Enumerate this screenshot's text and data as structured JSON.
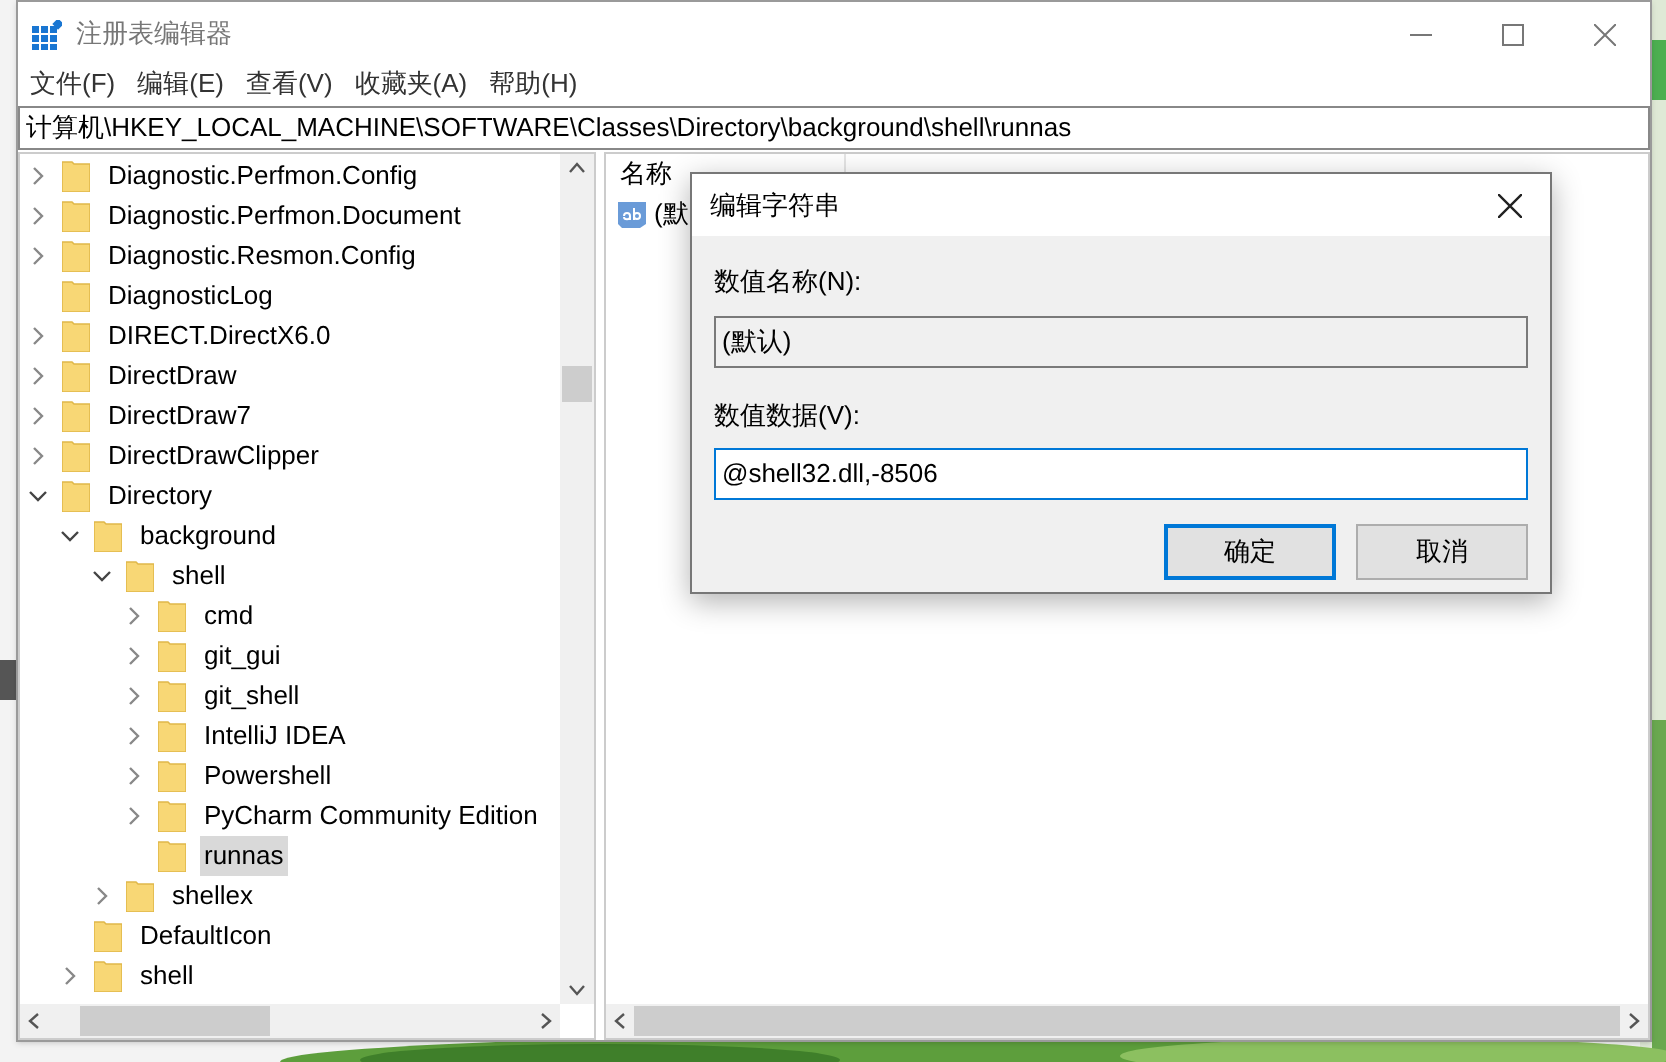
{
  "window": {
    "title": "注册表编辑器"
  },
  "menu": [
    {
      "label": "文件(F)"
    },
    {
      "label": "编辑(E)"
    },
    {
      "label": "查看(V)"
    },
    {
      "label": "收藏夹(A)"
    },
    {
      "label": "帮助(H)"
    }
  ],
  "address": "计算机\\HKEY_LOCAL_MACHINE\\SOFTWARE\\Classes\\Directory\\background\\shell\\runnas",
  "tree": [
    {
      "label": "Diagnostic.Perfmon.Config",
      "expanded": false,
      "selected": false
    },
    {
      "label": "Diagnostic.Perfmon.Document",
      "expanded": false,
      "selected": false
    },
    {
      "label": "Diagnostic.Resmon.Config",
      "expanded": false,
      "selected": false
    },
    {
      "label": "DiagnosticLog",
      "selected": false
    },
    {
      "label": "DIRECT.DirectX6.0",
      "expanded": false,
      "selected": false
    },
    {
      "label": "DirectDraw",
      "expanded": false,
      "selected": false
    },
    {
      "label": "DirectDraw7",
      "expanded": false,
      "selected": false
    },
    {
      "label": "DirectDrawClipper",
      "expanded": false,
      "selected": false
    },
    {
      "label": "Directory",
      "expanded": true,
      "selected": false,
      "children": [
        {
          "label": "background",
          "expanded": true,
          "selected": false,
          "children": [
            {
              "label": "shell",
              "expanded": true,
              "selected": false,
              "children": [
                {
                  "label": "cmd",
                  "expanded": false,
                  "selected": false
                },
                {
                  "label": "git_gui",
                  "expanded": false,
                  "selected": false
                },
                {
                  "label": "git_shell",
                  "expanded": false,
                  "selected": false
                },
                {
                  "label": "IntelliJ IDEA",
                  "expanded": false,
                  "selected": false
                },
                {
                  "label": "Powershell",
                  "expanded": false,
                  "selected": false
                },
                {
                  "label": "PyCharm Community Edition",
                  "expanded": false,
                  "selected": false
                },
                {
                  "label": "runnas",
                  "selected": true
                }
              ]
            },
            {
              "label": "shellex",
              "expanded": false,
              "selected": false
            }
          ]
        },
        {
          "label": "DefaultIcon",
          "selected": false
        },
        {
          "label": "shell",
          "expanded": false,
          "selected": false
        }
      ]
    }
  ],
  "values": {
    "columns": [
      "名称"
    ],
    "rows": [
      {
        "name": "(默"
      }
    ]
  },
  "dialog": {
    "title": "编辑字符串",
    "name_label": "数值名称(N):",
    "name_value": "(默认)",
    "data_label": "数值数据(V):",
    "data_value": "@shell32.dll,-8506",
    "buttons": [
      {
        "label": "确定",
        "default": true
      },
      {
        "label": "取消",
        "default": false
      }
    ]
  }
}
